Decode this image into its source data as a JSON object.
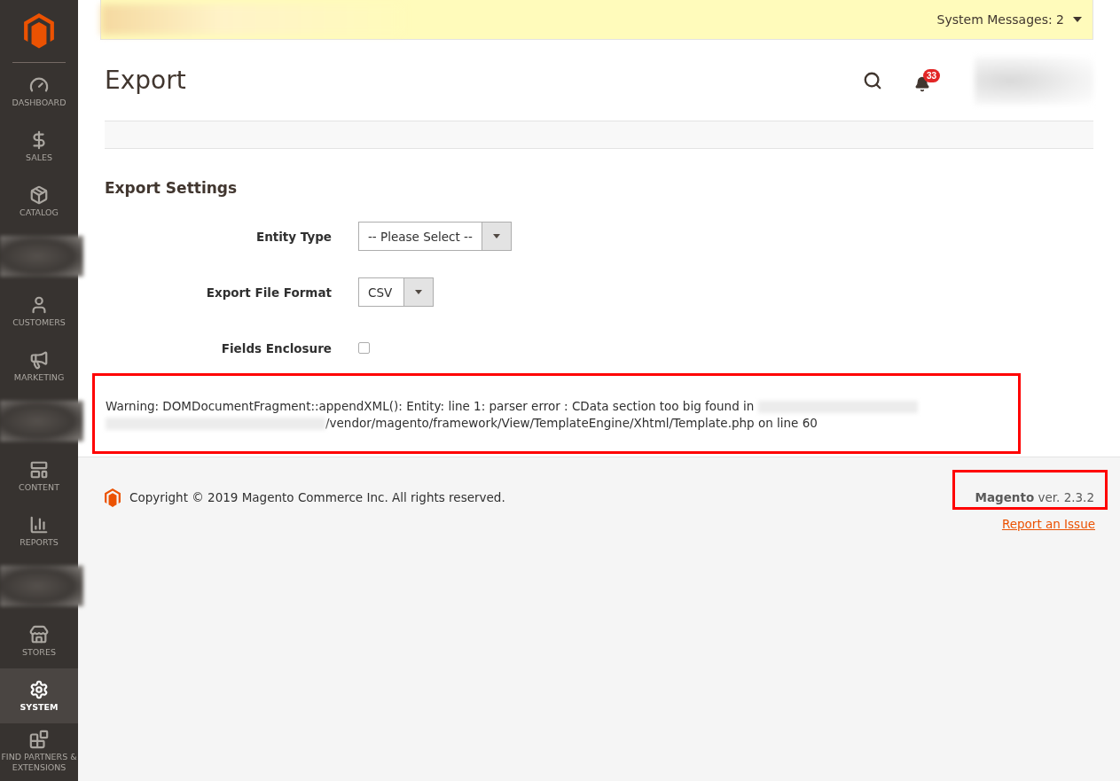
{
  "sidebar": {
    "items": [
      {
        "kind": "item",
        "label": "DASHBOARD",
        "selected": false
      },
      {
        "kind": "item",
        "label": "SALES",
        "selected": false
      },
      {
        "kind": "item",
        "label": "CATALOG",
        "selected": false
      },
      {
        "kind": "blurred"
      },
      {
        "kind": "item",
        "label": "CUSTOMERS",
        "selected": false
      },
      {
        "kind": "item",
        "label": "MARKETING",
        "selected": false
      },
      {
        "kind": "blurred"
      },
      {
        "kind": "item",
        "label": "CONTENT",
        "selected": false
      },
      {
        "kind": "item",
        "label": "REPORTS",
        "selected": false
      },
      {
        "kind": "blurred"
      },
      {
        "kind": "item",
        "label": "STORES",
        "selected": false
      },
      {
        "kind": "item",
        "label": "SYSTEM",
        "selected": true
      },
      {
        "kind": "item",
        "label": "FIND PARTNERS & EXTENSIONS",
        "selected": false
      }
    ]
  },
  "system_messages": {
    "label": "System Messages: 2"
  },
  "header": {
    "title": "Export",
    "notifications": "33"
  },
  "section_title": "Export Settings",
  "fields": [
    {
      "kind": "select",
      "label": "Entity Type",
      "value": "-- Please Select --"
    },
    {
      "kind": "select",
      "label": "Export File Format",
      "value": "CSV"
    },
    {
      "kind": "checkbox",
      "label": "Fields Enclosure",
      "checked": false
    }
  ],
  "warning": {
    "line_1": "Warning: DOMDocumentFragment::appendXML(): Entity: line 1: parser error : CData section too big found in",
    "line_2": "/vendor/magento/framework/View/TemplateEngine/Xhtml/Template.php on line 60"
  },
  "footer": {
    "copyright": "Copyright © 2019 Magento Commerce Inc. All rights reserved.",
    "brand": "Magento",
    "version": "ver. 2.3.2",
    "report_link": "Report an Issue"
  }
}
